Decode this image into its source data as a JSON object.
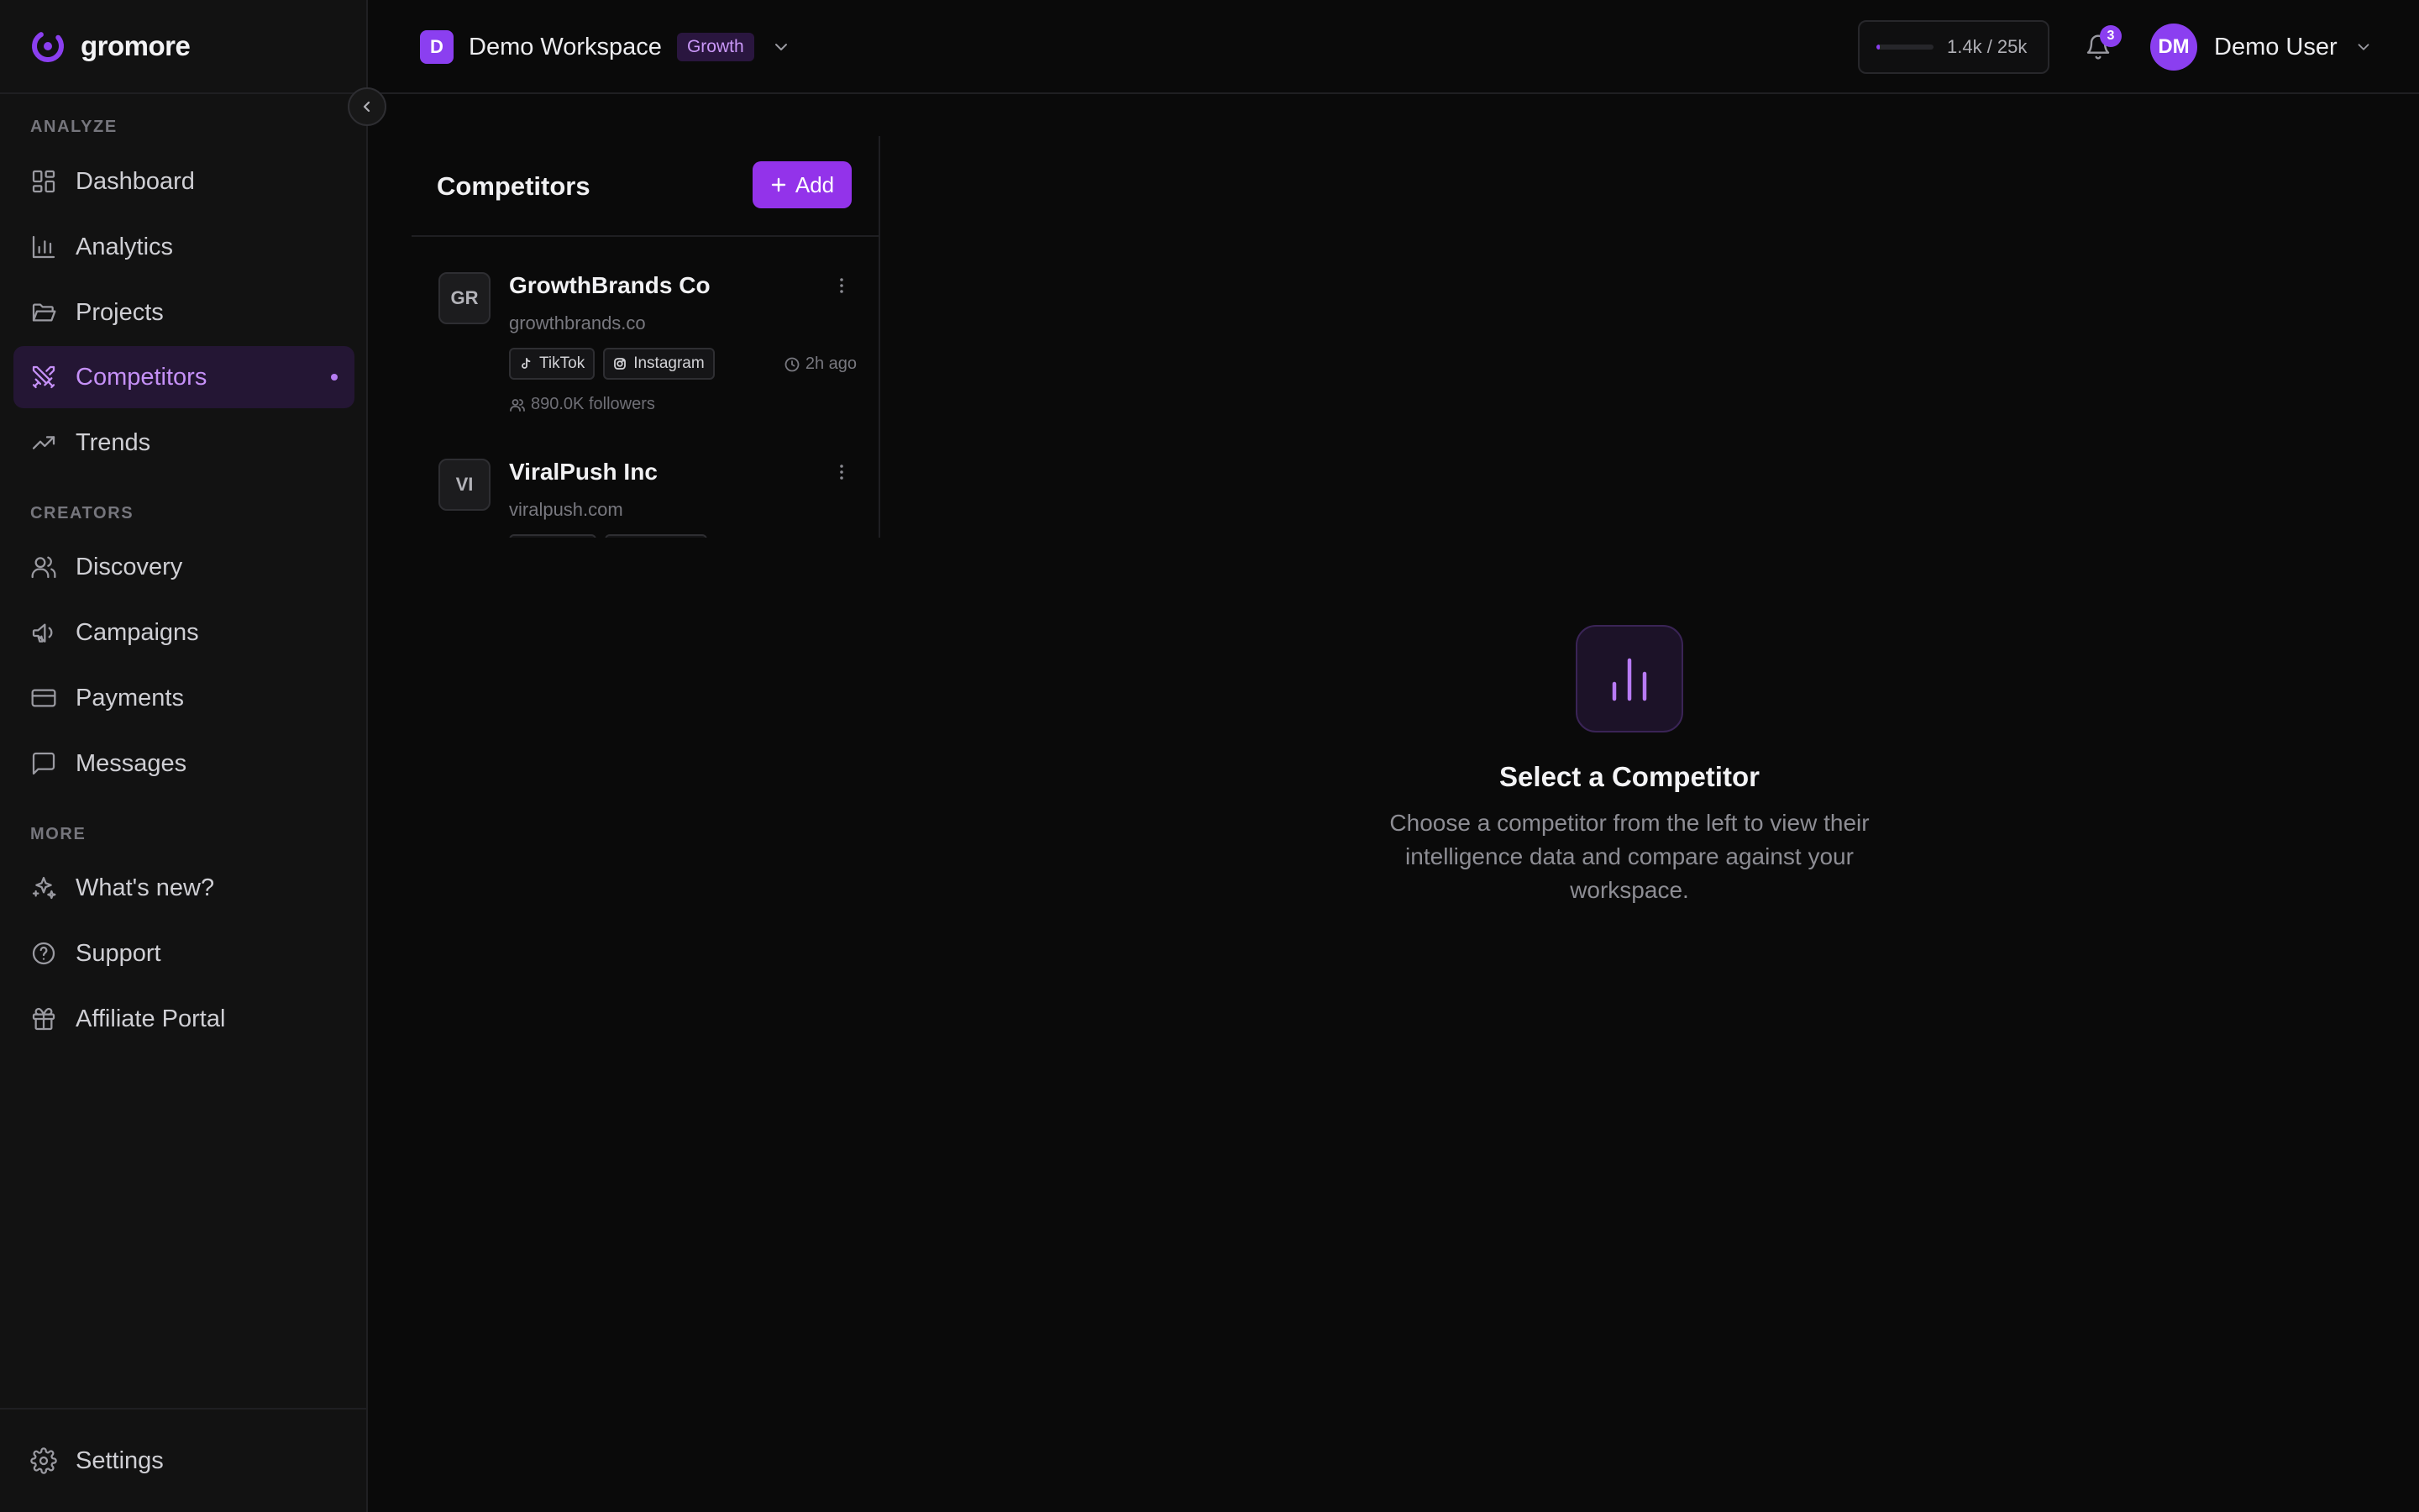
{
  "brand": {
    "name": "gromore",
    "accent": "#8b3ff0"
  },
  "sidebar": {
    "sections": [
      {
        "label": "ANALYZE"
      },
      {
        "label": "CREATORS"
      },
      {
        "label": "MORE"
      }
    ],
    "items": [
      {
        "label": "Dashboard",
        "icon": "dashboard-icon"
      },
      {
        "label": "Analytics",
        "icon": "bar-chart-icon"
      },
      {
        "label": "Projects",
        "icon": "folder-open-icon"
      },
      {
        "label": "Competitors",
        "icon": "swords-icon",
        "active": true
      },
      {
        "label": "Trends",
        "icon": "trending-up-icon"
      },
      {
        "label": "Discovery",
        "icon": "users-icon"
      },
      {
        "label": "Campaigns",
        "icon": "megaphone-icon"
      },
      {
        "label": "Payments",
        "icon": "credit-card-icon"
      },
      {
        "label": "Messages",
        "icon": "message-square-icon"
      },
      {
        "label": "What's new?",
        "icon": "sparkles-icon"
      },
      {
        "label": "Support",
        "icon": "help-circle-icon"
      },
      {
        "label": "Affiliate Portal",
        "icon": "gift-icon"
      }
    ],
    "settings": {
      "label": "Settings",
      "icon": "gear-icon"
    }
  },
  "header": {
    "workspace": {
      "initial": "D",
      "name": "Demo Workspace",
      "plan": "Growth"
    },
    "usage": {
      "text": "1.4k / 25k",
      "fraction": 0.056
    },
    "notifications": {
      "count": "3"
    },
    "user": {
      "initials": "DM",
      "name": "Demo User"
    }
  },
  "competitors": {
    "title": "Competitors",
    "add_label": "Add",
    "items": [
      {
        "initials": "GR",
        "name": "GrowthBrands Co",
        "domain": "growthbrands.co",
        "tags": [
          "TikTok",
          "Instagram"
        ],
        "updated": "2h ago",
        "followers": "890.0K followers"
      },
      {
        "initials": "VI",
        "name": "ViralPush Inc",
        "domain": "viralpush.com",
        "tags": [],
        "updated": "",
        "followers": ""
      }
    ]
  },
  "empty_state": {
    "title": "Select a Competitor",
    "description": "Choose a competitor from the left to view their intelligence data and compare against your workspace.",
    "icon": "bar-chart-icon"
  }
}
